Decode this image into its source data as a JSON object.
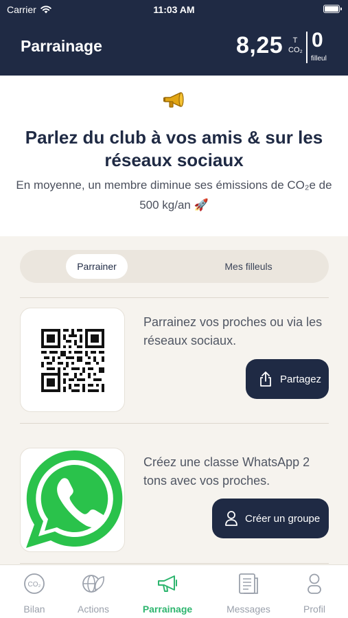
{
  "status_bar": {
    "carrier": "Carrier",
    "time": "11:03 AM"
  },
  "header": {
    "title": "Parrainage",
    "co2_value": "8,25",
    "co2_unit_top": "T",
    "co2_unit_bottom": "CO₂",
    "filleul_count": "0",
    "filleul_label": "filleul"
  },
  "intro": {
    "title": "Parlez du club à vos amis & sur les réseaux sociaux",
    "subtitle": "En moyenne, un membre diminue ses émissions de CO₂e de 500 kg/an 🚀"
  },
  "segments": {
    "active": "Parrainer",
    "other": "Mes filleuls"
  },
  "share_card": {
    "text": "Parrainez vos proches ou via les réseaux sociaux.",
    "button_label": "Partagez"
  },
  "whatsapp_card": {
    "text": "Créez une classe WhatsApp 2 tons avec vos proches.",
    "button_label": "Créer un groupe"
  },
  "tabs": [
    {
      "label": "Bilan",
      "icon": "co2-icon"
    },
    {
      "label": "Actions",
      "icon": "globe-leaf-icon"
    },
    {
      "label": "Parrainage",
      "icon": "megaphone-icon"
    },
    {
      "label": "Messages",
      "icon": "messages-icon"
    },
    {
      "label": "Profil",
      "icon": "profile-icon"
    }
  ],
  "colors": {
    "navy": "#1f2a44",
    "accent_green": "#2db56e",
    "whatsapp_green": "#2ac24b",
    "background": "#f6f3ee"
  }
}
